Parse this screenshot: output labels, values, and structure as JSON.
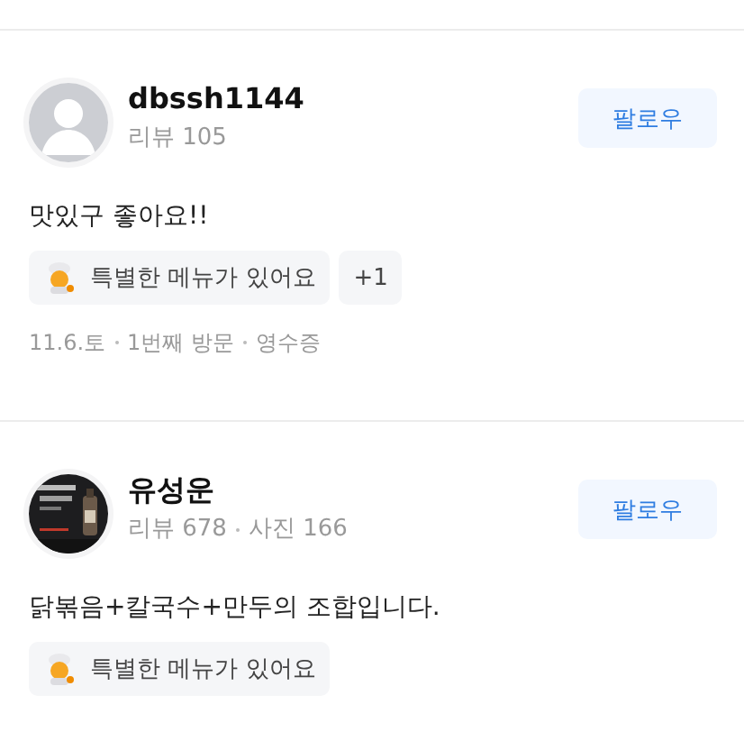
{
  "reviews": [
    {
      "author": "dbssh1144",
      "avatar": {
        "kind": "default"
      },
      "stats": [
        "리뷰 105"
      ],
      "follow": "팔로우",
      "text": "맛있구 좋아요!!",
      "tags": [
        "특별한 메뉴가 있어요"
      ],
      "more_tags": "+1",
      "meta": [
        "11.6.토",
        "1번째 방문",
        "영수증"
      ]
    },
    {
      "author": "유성운",
      "avatar": {
        "kind": "picture"
      },
      "stats": [
        "리뷰 678",
        "사진 166"
      ],
      "follow": "팔로우",
      "text": "닭볶음+칼국수+만두의 조합입니다.",
      "tags": [
        "특별한 메뉴가 있어요"
      ]
    }
  ]
}
